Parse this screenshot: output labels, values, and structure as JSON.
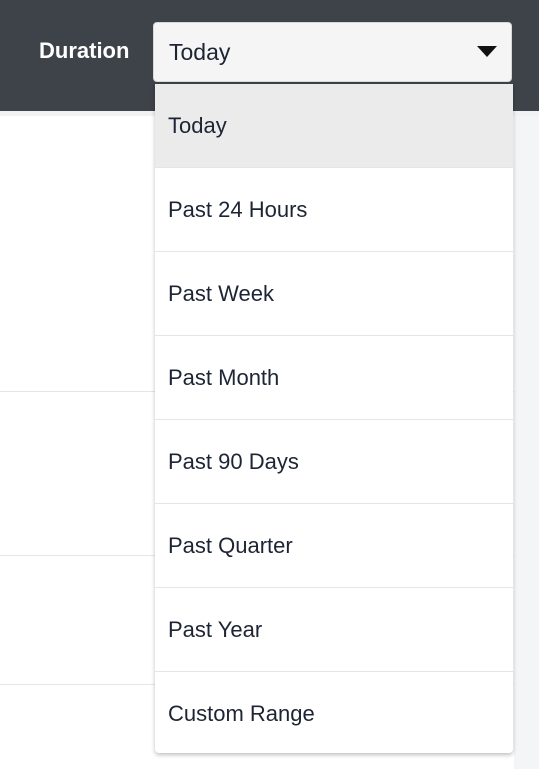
{
  "header": {
    "duration_label": "Duration",
    "select": {
      "value": "Today"
    }
  },
  "dropdown": {
    "options": [
      {
        "label": "Today",
        "selected": true
      },
      {
        "label": "Past 24 Hours"
      },
      {
        "label": "Past Week"
      },
      {
        "label": "Past Month"
      },
      {
        "label": "Past 90 Days"
      },
      {
        "label": "Past Quarter"
      },
      {
        "label": "Past Year"
      },
      {
        "label": "Custom Range"
      }
    ]
  },
  "colors": {
    "top_bar": "#3e4349",
    "selected_option_bg": "#ebebeb",
    "text": "#1d2433"
  }
}
